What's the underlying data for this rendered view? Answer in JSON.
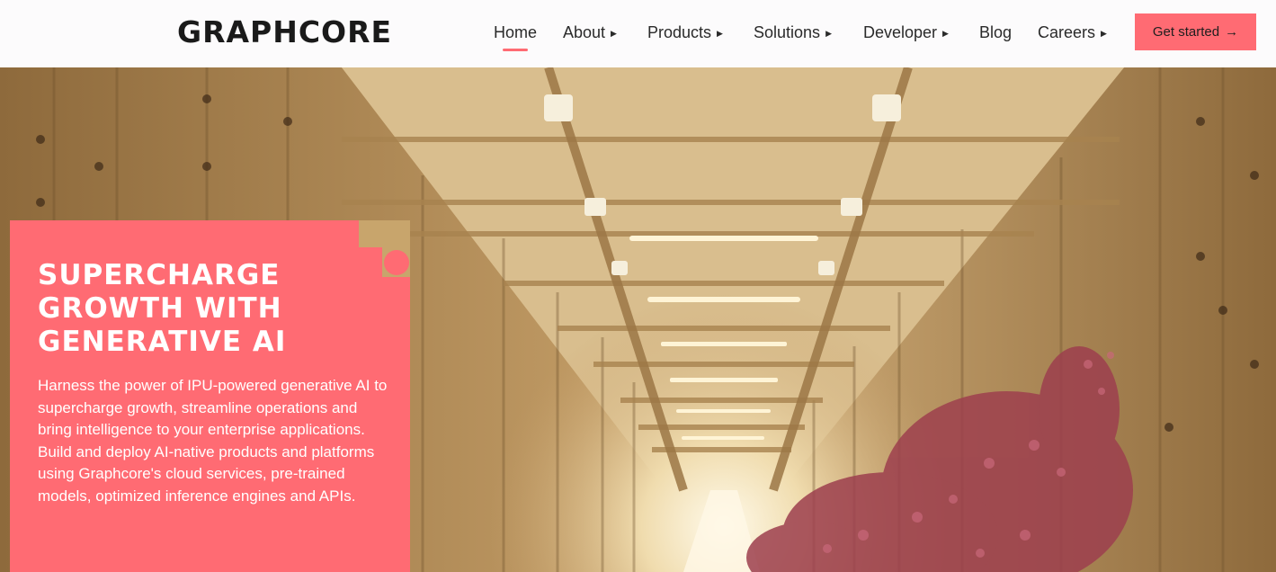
{
  "brand": {
    "logo_text": "GRAPHCORE"
  },
  "nav": {
    "items": [
      {
        "label": "Home",
        "has_submenu": false,
        "active": true
      },
      {
        "label": "About",
        "has_submenu": true
      },
      {
        "label": "Products",
        "has_submenu": true
      },
      {
        "label": "Solutions",
        "has_submenu": true
      },
      {
        "label": "Developer",
        "has_submenu": true
      },
      {
        "label": "Blog",
        "has_submenu": false
      },
      {
        "label": "Careers",
        "has_submenu": true
      }
    ],
    "submenu_icon": "triangle-right-icon",
    "cta_label": "Get started",
    "cta_icon": "arrow-right-icon"
  },
  "hero": {
    "title": "SUPERCHARGE GROWTH WITH GENERATIVE AI",
    "body": "Harness the power of IPU-powered generative AI to supercharge growth, streamline operations and bring intelligence to your enterprise applications. Build and deploy AI-native products and platforms using Graphcore's cloud services, pre-trained models, optimized inference engines and APIs."
  },
  "colors": {
    "accent": "#ff6b73",
    "header_bg": "#fcfbfc",
    "text_dark": "#2a2a2a",
    "hero_tint": "#c8a56c"
  }
}
